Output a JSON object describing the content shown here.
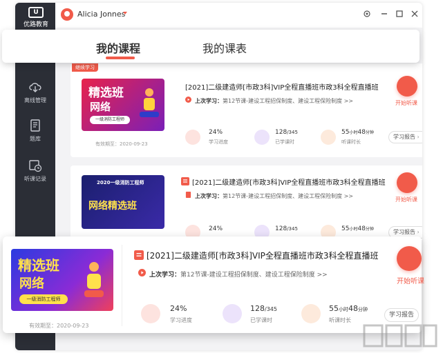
{
  "app": {
    "logo_text": "优路教育",
    "logo_mark": "U"
  },
  "sidebar": {
    "items": [
      {
        "label": "离线管理",
        "icon": "cloud-download-icon"
      },
      {
        "label": "题库",
        "icon": "book-icon"
      },
      {
        "label": "听课记录",
        "icon": "calendar-clock-icon"
      }
    ]
  },
  "titlebar": {
    "username": "Alicia Jonnes"
  },
  "tabs": [
    {
      "label": "我的课程",
      "active": true
    },
    {
      "label": "我的课表",
      "active": false
    }
  ],
  "colors": {
    "accent": "#f15b4a",
    "sidebar": "#2b2e36"
  },
  "courses": [
    {
      "badge": "继续学习",
      "thumb_line1": "精选班",
      "thumb_line2": "网络",
      "thumb_chip": "一级消防工程师",
      "title": "[2021]二级建造师[市政3科]VIP全程直播班市政3科全程直播班",
      "last_label": "上次学习：",
      "last_value": "第12节课-建设工程招保制度、建设工程保险制度 >>",
      "start_label": "开始听课",
      "progress": "24%",
      "progress_label": "学习进度",
      "hours_done": "128",
      "hours_total": "/345",
      "hours_label": "已学课时",
      "duration_h": "55",
      "duration_h_unit": "小时",
      "duration_m": "48",
      "duration_m_unit": "分钟",
      "duration_label": "听课时长",
      "report": "学习报告",
      "validity": "有效期至：2020-09-23"
    },
    {
      "thumb_top": "2020一级消防工程师",
      "thumb_line1": "网络精选班",
      "title": "[2021]二级建造师[市政3科]VIP全程直播班市政3科全程直播班",
      "last_label": "上次学习：",
      "last_value": "第12节课-建设工程招保制度、建设工程保险制度 >>",
      "start_label": "开始听课",
      "progress": "24%",
      "hours_done": "128",
      "hours_total": "/345",
      "duration_h": "55",
      "duration_h_unit": "小时",
      "duration_m": "48",
      "duration_m_unit": "分钟",
      "report": "学习报告"
    }
  ],
  "featured": {
    "thumb_line1": "精选班",
    "thumb_line2": "网络",
    "thumb_chip": "一级消防工程师",
    "title": "[2021]二级建造师[市政3科]VIP全程直播班市政3科全程直播班",
    "last_label": "上次学习：",
    "last_value": "第12节课-建设工程招保制度、建设工程保险制度 >>",
    "start_label": "开始听课",
    "progress": "24%",
    "progress_label": "学习进度",
    "hours_done": "128",
    "hours_total": "/345",
    "hours_label": "已学课时",
    "duration_h": "55",
    "duration_h_unit": "小时",
    "duration_m": "48",
    "duration_m_unit": "分钟",
    "duration_label": "听课时长",
    "report": "学习报告",
    "validity": "有效期至：2020-09-23"
  }
}
